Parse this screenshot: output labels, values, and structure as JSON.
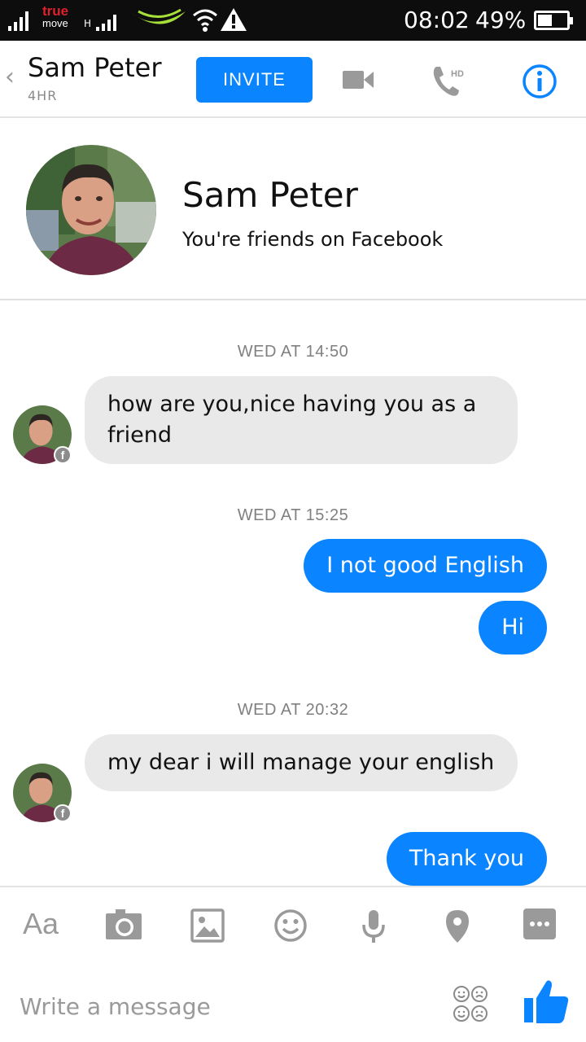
{
  "status_bar": {
    "carrier_line1": "true",
    "carrier_line2": "move",
    "network_type": "H",
    "time": "08:02",
    "battery_percent": "49%",
    "battery_level": 0.49
  },
  "header": {
    "contact_name": "Sam Peter",
    "last_active": "4HR",
    "invite_label": "INVITE",
    "phone_badge": "HD"
  },
  "profile": {
    "name": "Sam Peter",
    "relationship": "You're friends on Facebook"
  },
  "messages": [
    {
      "timestamp": "WED AT 14:50"
    },
    {
      "text": "how are you,nice having you as a friend",
      "direction": "incoming"
    },
    {
      "timestamp": "WED AT 15:25"
    },
    {
      "text": "I not good English",
      "direction": "outgoing"
    },
    {
      "text": "Hi",
      "direction": "outgoing"
    },
    {
      "timestamp": "WED AT 20:32"
    },
    {
      "text": "my dear i will manage your english",
      "direction": "incoming"
    },
    {
      "text": "Thank you",
      "direction": "outgoing"
    }
  ],
  "composer": {
    "text_format_label": "Aa",
    "placeholder": "Write a message",
    "toolbar_icons": [
      "text-format-icon",
      "camera-icon",
      "gallery-icon",
      "emoji-icon",
      "microphone-icon",
      "location-icon",
      "more-icon"
    ]
  },
  "colors": {
    "accent": "#0a84ff",
    "incoming_bubble": "#e9e9e9",
    "icon_gray": "#9a9a9a",
    "status_bar": "#0d0d0d"
  }
}
